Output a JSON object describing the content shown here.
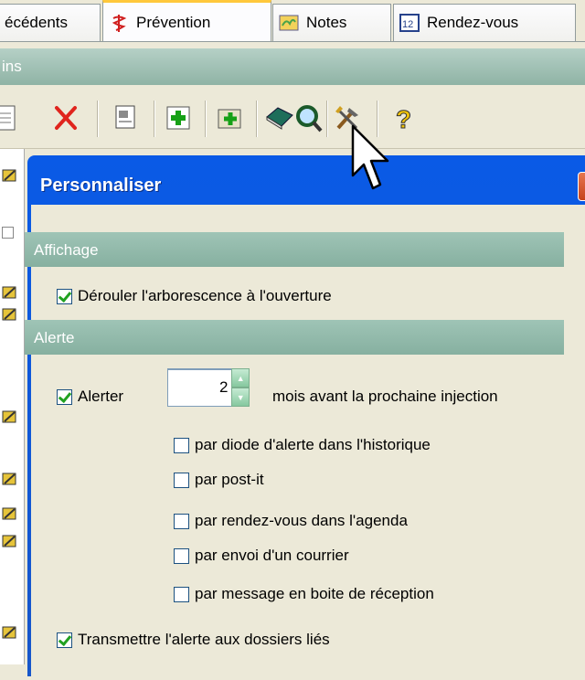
{
  "tabs": [
    {
      "label": "écédents",
      "icon": "folder-icon"
    },
    {
      "label": "Prévention",
      "icon": "caduceus-icon",
      "active": true
    },
    {
      "label": "Notes",
      "icon": "notes-icon"
    },
    {
      "label": "Rendez-vous",
      "icon": "calendar-icon"
    }
  ],
  "section": {
    "title": "ins"
  },
  "toolbar": {
    "items": [
      "page-icon",
      "delete-icon",
      "print-preview-icon",
      "add-icon",
      "add-folder-icon",
      "book-icon",
      "search-icon",
      "tools-icon",
      "help-icon"
    ]
  },
  "dialog": {
    "title": "Personnaliser",
    "groups": {
      "display": {
        "title": "Affichage"
      },
      "alert": {
        "title": "Alerte"
      }
    },
    "expand_tree": {
      "label": "Dérouler l'arborescence à l'ouverture",
      "checked": true
    },
    "alert_row": {
      "label": "Alerter",
      "checked": true,
      "months": "2",
      "suffix": "mois avant la prochaine injection"
    },
    "options": [
      {
        "label": "par diode d'alerte dans l'historique",
        "checked": false
      },
      {
        "label": "par post-it",
        "checked": false
      },
      {
        "label": "par rendez-vous dans l'agenda",
        "checked": false
      },
      {
        "label": "par envoi d'un courrier",
        "checked": false
      },
      {
        "label": "par message en boite de réception",
        "checked": false
      }
    ],
    "transmit": {
      "label": "Transmettre l'alerte aux dossiers liés",
      "checked": true
    }
  },
  "colors": {
    "title_blue": "#0a5ae6",
    "group_green": "#8fb3a5",
    "tab_highlight": "#ffc83c"
  }
}
